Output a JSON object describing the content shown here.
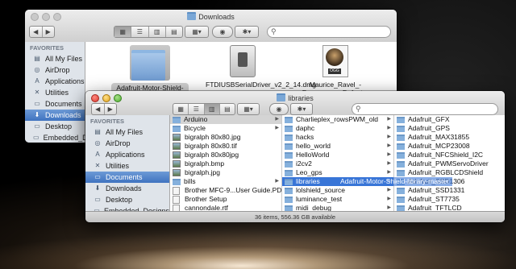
{
  "back_window": {
    "title": "Downloads",
    "sidebar": {
      "heading": "FAVORITES",
      "items": [
        {
          "label": "All My Files",
          "icon": "all-files-icon"
        },
        {
          "label": "AirDrop",
          "icon": "airdrop-icon"
        },
        {
          "label": "Applications",
          "icon": "applications-icon"
        },
        {
          "label": "Utilities",
          "icon": "utilities-icon"
        },
        {
          "label": "Documents",
          "icon": "documents-icon"
        },
        {
          "label": "Downloads",
          "icon": "downloads-icon"
        },
        {
          "label": "Desktop",
          "icon": "desktop-icon"
        },
        {
          "label": "Embedded_Designs",
          "icon": "folder-icon"
        }
      ]
    },
    "files": [
      {
        "label": "Adafruit-Motor-Shield-library-master",
        "kind": "folder"
      },
      {
        "label": "FTDIUSBSerialDriver_v2_2_14.dmg",
        "kind": "dmg"
      },
      {
        "label": "Maurice_Ravel_-_Pavane_po...Defunte.ogg",
        "kind": "ogg"
      }
    ]
  },
  "front_window": {
    "title": "libraries",
    "sidebar": {
      "heading": "FAVORITES",
      "items": [
        {
          "label": "All My Files",
          "icon": "all-files-icon"
        },
        {
          "label": "AirDrop",
          "icon": "airdrop-icon"
        },
        {
          "label": "Applications",
          "icon": "applications-icon"
        },
        {
          "label": "Utilities",
          "icon": "utilities-icon"
        },
        {
          "label": "Documents",
          "icon": "documents-icon"
        },
        {
          "label": "Downloads",
          "icon": "downloads-icon"
        },
        {
          "label": "Desktop",
          "icon": "desktop-icon"
        },
        {
          "label": "Embedded_Designs",
          "icon": "folder-icon"
        }
      ]
    },
    "columns": {
      "col1": [
        {
          "label": "Arduino",
          "kind": "folder",
          "arrow": true,
          "state": "sel2"
        },
        {
          "label": "Bicycle",
          "kind": "folder",
          "arrow": true
        },
        {
          "label": "bigralph 80x80.jpg",
          "kind": "img"
        },
        {
          "label": "bigralph 80x80.tif",
          "kind": "img"
        },
        {
          "label": "bigralph 80x80jpg",
          "kind": "img"
        },
        {
          "label": "bigralph.bmp",
          "kind": "img"
        },
        {
          "label": "bigralph.jpg",
          "kind": "img"
        },
        {
          "label": "bills",
          "kind": "folder",
          "arrow": true
        },
        {
          "label": "Brother MFC-9...User Guide.PDF",
          "kind": "file"
        },
        {
          "label": "Brother Setup",
          "kind": "file"
        },
        {
          "label": "cannondale.rtf",
          "kind": "file"
        }
      ],
      "col2": [
        {
          "label": "Charlieplex_rowsPWM_old",
          "kind": "folder",
          "arrow": true
        },
        {
          "label": "daphc",
          "kind": "folder",
          "arrow": true
        },
        {
          "label": "hacks",
          "kind": "folder",
          "arrow": true
        },
        {
          "label": "hello_world",
          "kind": "folder",
          "arrow": true
        },
        {
          "label": "HelloWorld",
          "kind": "folder",
          "arrow": true
        },
        {
          "label": "i2cv2",
          "kind": "folder",
          "arrow": true
        },
        {
          "label": "Leo_gps",
          "kind": "folder",
          "arrow": true
        },
        {
          "label": "libraries",
          "kind": "folder",
          "arrow": true,
          "state": "sel"
        },
        {
          "label": "lolshield_source",
          "kind": "folder",
          "arrow": true
        },
        {
          "label": "luminance_test",
          "kind": "folder",
          "arrow": true
        },
        {
          "label": "midi_debug",
          "kind": "folder",
          "arrow": true
        }
      ],
      "col3": [
        {
          "label": "Adafruit_GFX",
          "kind": "folder"
        },
        {
          "label": "Adafruit_GPS",
          "kind": "folder"
        },
        {
          "label": "Adafruit_MAX31855",
          "kind": "folder"
        },
        {
          "label": "Adafruit_MCP23008",
          "kind": "folder"
        },
        {
          "label": "Adafruit_NFCShield_I2C",
          "kind": "folder"
        },
        {
          "label": "Adafruit_PWMServoDriver",
          "kind": "folder"
        },
        {
          "label": "Adafruit_RGBLCDShield",
          "kind": "folder"
        },
        {
          "label": "Adafruit_SSD1306",
          "kind": "folder"
        },
        {
          "label": "Adafruit_SSD1331",
          "kind": "folder"
        },
        {
          "label": "Adafruit_ST7735",
          "kind": "folder"
        },
        {
          "label": "Adafruit_TFTLCD",
          "kind": "folder"
        }
      ]
    },
    "drag_label": "Adafruit-Motor-Shield-library-master",
    "status": "36 items, 556.36 GB available"
  }
}
